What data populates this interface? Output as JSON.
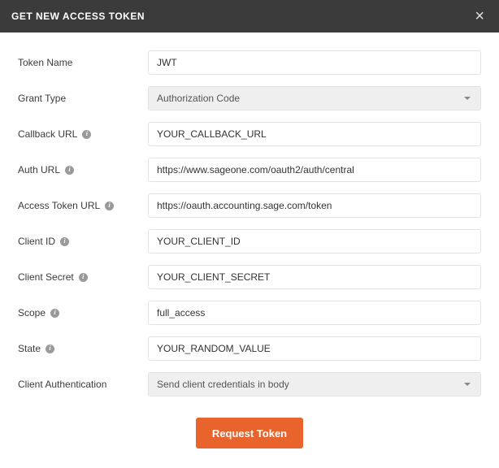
{
  "header": {
    "title": "GET NEW ACCESS TOKEN"
  },
  "form": {
    "token_name": {
      "label": "Token Name",
      "value": "JWT"
    },
    "grant_type": {
      "label": "Grant Type",
      "selected": "Authorization Code"
    },
    "callback_url": {
      "label": "Callback URL",
      "value": "YOUR_CALLBACK_URL"
    },
    "auth_url": {
      "label": "Auth URL",
      "value": "https://www.sageone.com/oauth2/auth/central"
    },
    "access_token_url": {
      "label": "Access Token URL",
      "value": "https://oauth.accounting.sage.com/token"
    },
    "client_id": {
      "label": "Client ID",
      "value": "YOUR_CLIENT_ID"
    },
    "client_secret": {
      "label": "Client Secret",
      "value": "YOUR_CLIENT_SECRET"
    },
    "scope": {
      "label": "Scope",
      "value": "full_access"
    },
    "state": {
      "label": "State",
      "value": "YOUR_RANDOM_VALUE"
    },
    "client_authentication": {
      "label": "Client Authentication",
      "selected": "Send client credentials in body"
    }
  },
  "buttons": {
    "request_token": "Request Token"
  },
  "icons": {
    "info": "i"
  }
}
